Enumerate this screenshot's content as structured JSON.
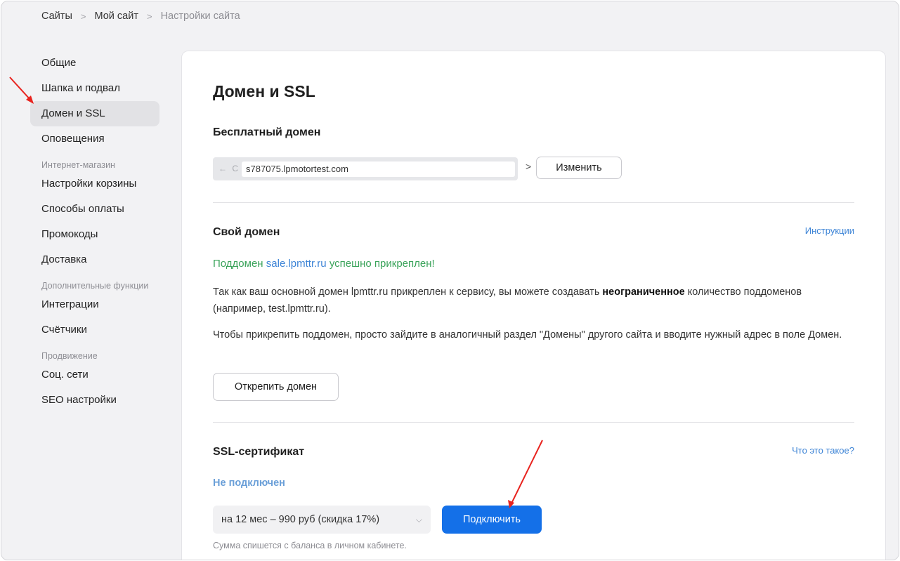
{
  "breadcrumb": {
    "items": [
      "Сайты",
      "Мой сайт",
      "Настройки сайта"
    ],
    "separator": ">"
  },
  "sidebar": {
    "items": [
      {
        "label": "Общие"
      },
      {
        "label": "Шапка и подвал"
      },
      {
        "label": "Домен и SSL",
        "active": true
      },
      {
        "label": "Оповещения"
      }
    ],
    "shop_group": "Интернет-магазин",
    "shop_items": [
      {
        "label": "Настройки корзины"
      },
      {
        "label": "Способы оплаты"
      },
      {
        "label": "Промокоды"
      },
      {
        "label": "Доставка"
      }
    ],
    "extra_group": "Дополнительные функции",
    "extra_items": [
      {
        "label": "Интеграции"
      },
      {
        "label": "Счётчики"
      }
    ],
    "promo_group": "Продвижение",
    "promo_items": [
      {
        "label": "Соц. сети"
      },
      {
        "label": "SEO настройки"
      }
    ]
  },
  "main": {
    "title": "Домен и SSL",
    "free_domain": {
      "title": "Бесплатный домен",
      "url": "s787075.lpmotortest.com",
      "nav_glyphs": "← C",
      "chevron": ">",
      "change_button": "Изменить"
    },
    "own_domain": {
      "title": "Свой домен",
      "instructions_link": "Инструкции",
      "success_prefix": "Поддомен",
      "success_domain": "sale.lpmttr.ru",
      "success_suffix": "успешно прикреплен!",
      "para1_a": "Так как ваш основной домен lpmttr.ru прикреплен к сервису, вы можете создавать",
      "para1_bold": "неограниченное",
      "para1_b": "количество поддоменов (например, test.lpmttr.ru).",
      "para2": "Чтобы прикрепить поддомен, просто зайдите в аналогичный раздел \"Домены\" другого сайта и вводите нужный адрес в поле Домен.",
      "detach_button": "Открепить домен"
    },
    "ssl": {
      "title": "SSL-сертификат",
      "what_link": "Что это такое?",
      "status": "Не подключен",
      "plan_select": "на 12 мес – 990 руб (скидка 17%)",
      "connect_button": "Подключить",
      "note": "Сумма спишется с баланса в личном кабинете."
    }
  },
  "colors": {
    "accent": "#1470e8",
    "link": "#3d84d6",
    "success": "#3aa35a",
    "annotation_arrow": "#e8231e"
  },
  "icons": [
    "back-arrow-icon",
    "reload-icon",
    "chevron-right-icon",
    "chevron-down-icon",
    "annotation-arrow-icon"
  ]
}
